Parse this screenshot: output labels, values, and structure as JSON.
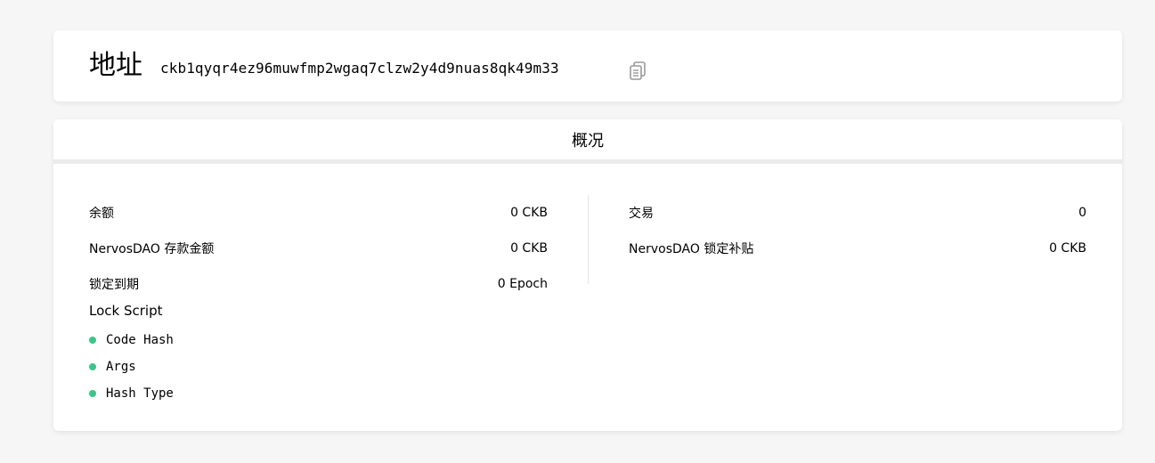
{
  "colors": {
    "accent_green": "#3cc68a",
    "background": "#f6f6f6",
    "card": "#ffffff",
    "divider": "#eaeaea"
  },
  "address": {
    "title": "地址",
    "hash": "ckb1qyqr4ez96muwfmp2wgaq7clzw2y4d9nuas8qk49m33",
    "copy_icon": "copy-icon"
  },
  "overview": {
    "title": "概况",
    "left": [
      {
        "label": "余额",
        "value": "0 CKB"
      },
      {
        "label": "NervosDAO 存款金额",
        "value": "0 CKB"
      },
      {
        "label": "锁定到期",
        "value": "0 Epoch"
      }
    ],
    "right": [
      {
        "label": "交易",
        "value": "0"
      },
      {
        "label": "NervosDAO 锁定补贴",
        "value": "0 CKB"
      }
    ],
    "lock_script": {
      "title": "Lock Script",
      "items": [
        "Code Hash",
        "Args",
        "Hash Type"
      ]
    }
  }
}
